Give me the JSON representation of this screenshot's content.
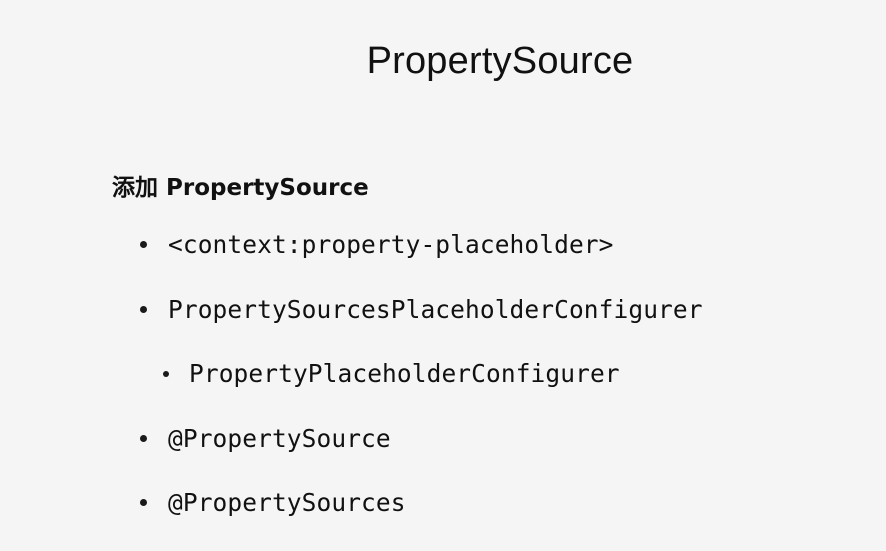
{
  "slide": {
    "title": "PropertySource",
    "heading": "添加 PropertySource",
    "items": [
      {
        "text": "<context:property-placeholder>",
        "level": 1
      },
      {
        "text": "PropertySourcesPlaceholderConfigurer",
        "level": 1
      },
      {
        "text": "PropertyPlaceholderConfigurer",
        "level": 2
      },
      {
        "text": "@PropertySource",
        "level": 1
      },
      {
        "text": "@PropertySources",
        "level": 1
      }
    ]
  }
}
